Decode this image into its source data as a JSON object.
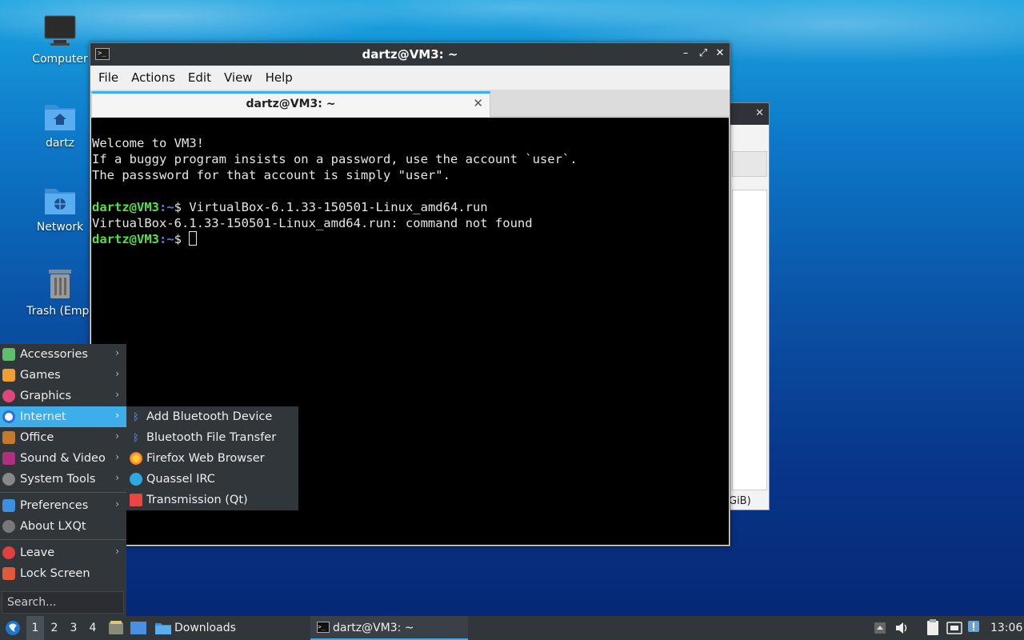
{
  "desktop": {
    "icons": [
      {
        "label": "Computer"
      },
      {
        "label": "dartz"
      },
      {
        "label": "Network"
      },
      {
        "label": "Trash (Empt"
      }
    ]
  },
  "background_window": {
    "footer_text": "GiB)"
  },
  "terminal_window": {
    "title": "dartz@VM3: ~",
    "menu": [
      "File",
      "Actions",
      "Edit",
      "View",
      "Help"
    ],
    "tab_label": "dartz@VM3: ~",
    "lines": [
      "Welcome to VM3!",
      "If a buggy program insists on a password, use the account `user`.",
      "The passsword for that account is simply \"user\"."
    ],
    "prompt_user": "dartz@VM3",
    "prompt_path": ":~",
    "prompt_symbol": "$ ",
    "command": "VirtualBox-6.1.33-150501-Linux_amd64.run",
    "output": "VirtualBox-6.1.33-150501-Linux_amd64.run: command not found"
  },
  "app_menu": {
    "categories": [
      {
        "label": "Accessories",
        "icon": "accessories-icon",
        "color": "#5fbf6c"
      },
      {
        "label": "Games",
        "icon": "games-icon",
        "color": "#f0a030"
      },
      {
        "label": "Graphics",
        "icon": "graphics-icon",
        "color": "#e0457b"
      },
      {
        "label": "Internet",
        "icon": "internet-icon",
        "color": "#2d6fd6"
      },
      {
        "label": "Office",
        "icon": "office-icon",
        "color": "#c47a2c"
      },
      {
        "label": "Sound & Video",
        "icon": "sound-video-icon",
        "color": "#b03080"
      },
      {
        "label": "System Tools",
        "icon": "system-tools-icon",
        "color": "#888888"
      }
    ],
    "preferences": "Preferences",
    "about": "About LXQt",
    "leave": "Leave",
    "lock": "Lock Screen",
    "search_placeholder": "Search..."
  },
  "internet_submenu": [
    {
      "label": "Add Bluetooth Device",
      "icon": "bluetooth-icon"
    },
    {
      "label": "Bluetooth File Transfer",
      "icon": "bluetooth-icon"
    },
    {
      "label": "Firefox Web Browser",
      "icon": "firefox-icon"
    },
    {
      "label": "Quassel IRC",
      "icon": "quassel-icon"
    },
    {
      "label": "Transmission (Qt)",
      "icon": "transmission-icon"
    }
  ],
  "taskbar": {
    "desktops": [
      "1",
      "2",
      "3",
      "4"
    ],
    "downloads_label": "Downloads",
    "task_label": "dartz@VM3: ~",
    "clock": "13:06"
  },
  "colors": {
    "accent": "#3daee9",
    "panel": "#31363b",
    "prompt_user": "#54e04c",
    "prompt_path": "#4f87d4"
  }
}
